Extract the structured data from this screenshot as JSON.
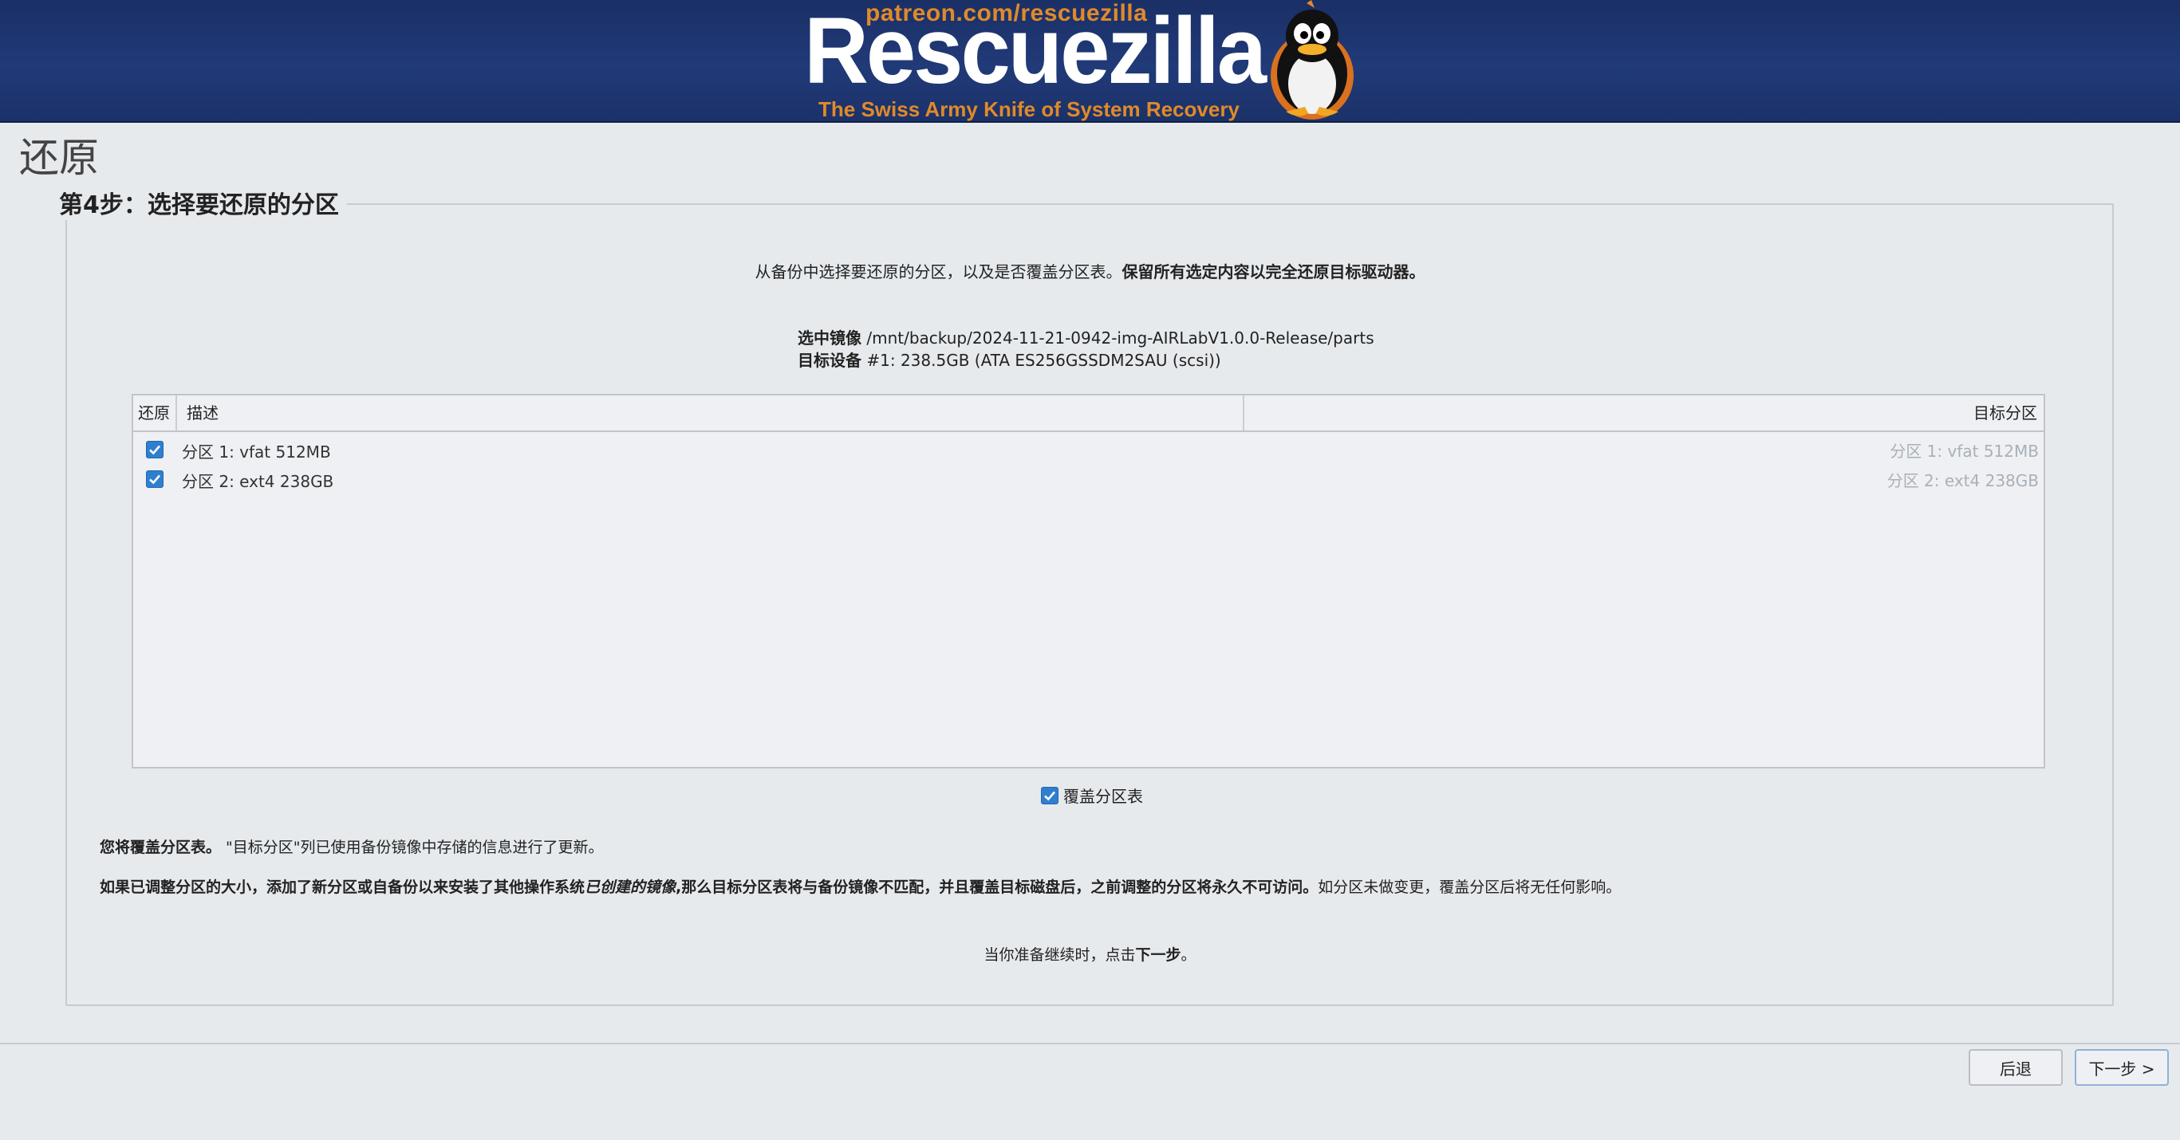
{
  "banner": {
    "url": "patreon.com/rescuezilla",
    "logo_text": "Rescuezilla",
    "tagline": "The Swiss Army Knife of System Recovery",
    "mascot_icon": "penguin-mascot-icon",
    "colors": {
      "background": "#1f3570",
      "accent": "#e08a2a"
    }
  },
  "page": {
    "title": "还原",
    "step_heading": "第4步：选择要还原的分区",
    "intro_plain": "从备份中选择要还原的分区，以及是否覆盖分区表。",
    "intro_bold": "保留所有选定内容以完全还原目标驱动器。",
    "image_label": "选中镜像",
    "image_value": "/mnt/backup/2024-11-21-0942-img-AIRLabV1.0.0-Release/parts",
    "device_label": "目标设备",
    "device_value": "#1: 238.5GB (ATA ES256GSSDM2SAU (scsi))"
  },
  "table": {
    "columns": {
      "restore": "还原",
      "description": "描述",
      "target": "目标分区"
    },
    "rows": [
      {
        "checked": true,
        "description": "分区 1: vfat 512MB",
        "target": "分区 1: vfat 512MB"
      },
      {
        "checked": true,
        "description": "分区 2: ext4 238GB",
        "target": "分区 2: ext4 238GB"
      }
    ]
  },
  "overwrite": {
    "checked": true,
    "label": "覆盖分区表"
  },
  "notes": {
    "n1_bold": "您将覆盖分区表。",
    "n1_plain": " \"目标分区\"列已使用备份镜像中存储的信息进行了更新。",
    "n2_bold_a": "如果已调整分区的大小，添加了新分区或自备份以来安装了其他操作系统",
    "n2_italic": "已创建的镜像",
    "n2_bold_b": ",那么目标分区表将与备份镜像不匹配，并且覆盖目标磁盘后，之前调整的分区将永久不可访问。",
    "n2_plain": "如分区未做变更，覆盖分区后将无任何影响。",
    "cont_plain": "当你准备继续时，点击",
    "cont_bold": "下一步",
    "cont_end": "。"
  },
  "buttons": {
    "back": "后退",
    "next": "下一步 >"
  }
}
